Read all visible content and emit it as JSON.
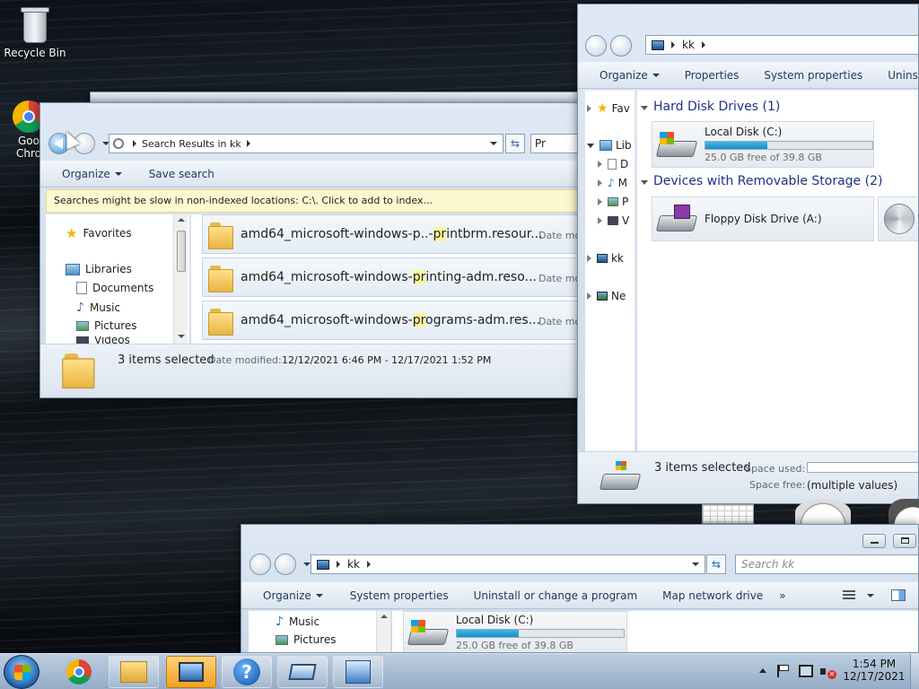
{
  "desktop": {
    "icons": [
      {
        "label": "Recycle Bin",
        "icon": "recycle-bin-icon"
      },
      {
        "label": "Goo…\nChro…",
        "label_line1": "Goo",
        "label_line2": "Chro",
        "icon": "chrome-icon"
      }
    ]
  },
  "search_window": {
    "address": "Search Results in kk",
    "search_box_value": "Pr",
    "toolbar": {
      "organize": "Organize",
      "save_search": "Save search"
    },
    "info_bar": "Searches might be slow in non-indexed locations: C:\\. Click to add to index...",
    "nav": {
      "favorites": "Favorites",
      "libraries": "Libraries",
      "documents": "Documents",
      "music": "Music",
      "pictures": "Pictures",
      "videos": "Videos"
    },
    "results": [
      {
        "pre": "amd64_microsoft-windows-p..-",
        "hl": "pr",
        "post": "intbrm.resour...",
        "date_label": "Date mo"
      },
      {
        "pre": "amd64_microsoft-windows-",
        "hl": "pr",
        "post": "inting-adm.reso...",
        "date_label": "Date mo"
      },
      {
        "pre": "amd64_microsoft-windows-",
        "hl": "pr",
        "post": "ograms-adm.res...",
        "date_label": "Date mo"
      }
    ],
    "status": {
      "count": "3 items selected",
      "date_label": "Date modified:",
      "date_range": "12/12/2021 6:46 PM - 12/17/2021 1:52 PM"
    }
  },
  "computer_window": {
    "address": "kk",
    "toolbar": {
      "organize": "Organize",
      "properties": "Properties",
      "system_properties": "System properties",
      "uninstall": "Uninstall or"
    },
    "nav": {
      "favorites": "Fav",
      "libraries": "Lib",
      "d": "D",
      "m": "M",
      "p": "P",
      "v": "V",
      "kk": "kk",
      "network": "Ne"
    },
    "hdd_group": "Hard Disk Drives (1)",
    "local_disk": {
      "name": "Local Disk (C:)",
      "free": "25.0 GB free of 39.8 GB",
      "used_fraction": 0.37
    },
    "removable_group": "Devices with Removable Storage (2)",
    "floppy": {
      "name": "Floppy Disk Drive (A:)"
    },
    "status": {
      "count": "3 items selected",
      "space_used_label": "Space used:",
      "space_free_label": "Space free:",
      "space_free_value": "(multiple values)"
    }
  },
  "bottom_window": {
    "address": "kk",
    "search_placeholder": "Search kk",
    "toolbar": {
      "organize": "Organize",
      "system_properties": "System properties",
      "uninstall": "Uninstall or change a program",
      "map_drive": "Map network drive",
      "more": "»"
    },
    "nav": {
      "music": "Music",
      "pictures": "Pictures"
    },
    "local_disk": {
      "name": "Local Disk (C:)",
      "free": "25.0 GB free of 39.8 GB",
      "used_fraction": 0.37
    }
  },
  "taskbar": {
    "time": "1:54 PM",
    "date": "12/17/2021"
  },
  "colors": {
    "highlight": "#fbf6a0",
    "accent": "#1e3287",
    "bar_fill": "#1a8fc9"
  }
}
